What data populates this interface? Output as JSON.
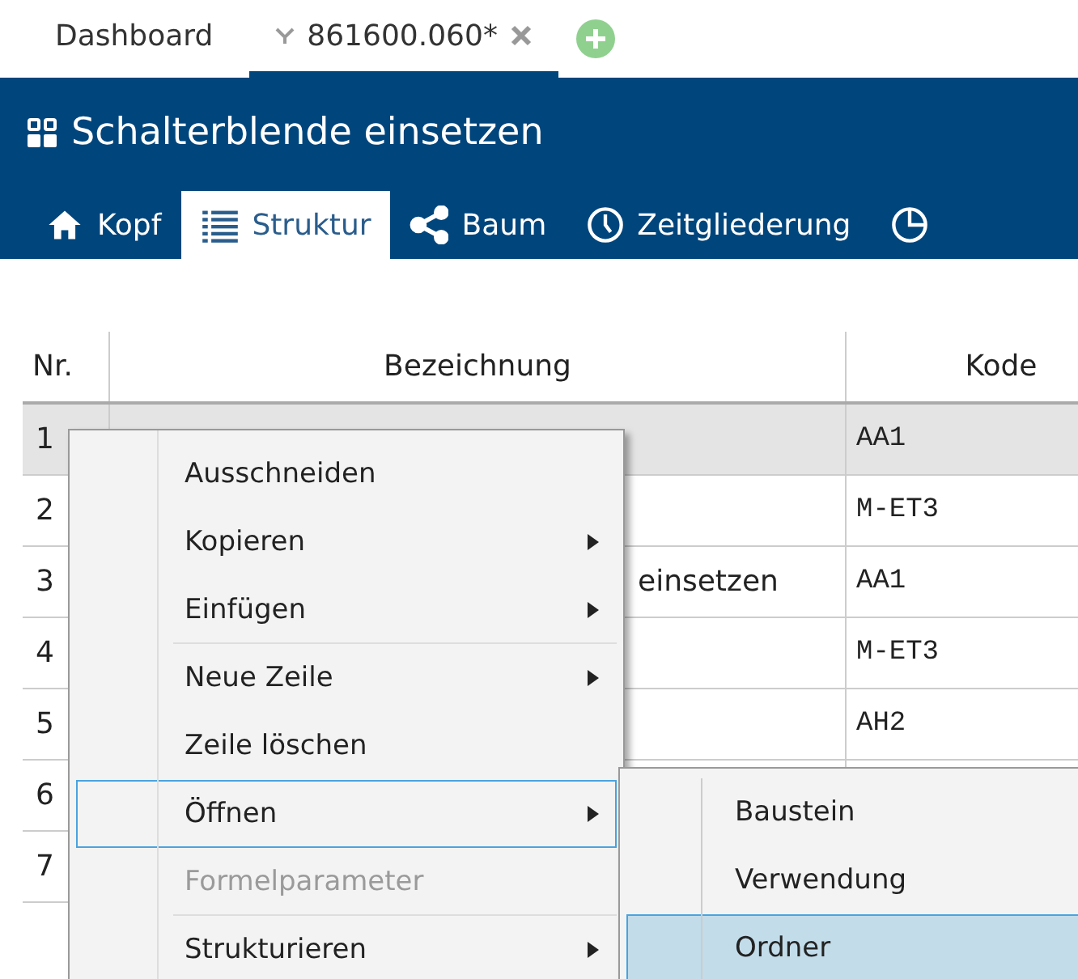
{
  "doc_tabs": [
    {
      "label": "Dashboard",
      "selected": false,
      "closable": false
    },
    {
      "label": "861600.060*",
      "selected": true,
      "closable": true
    }
  ],
  "header": {
    "title": "Schalterblende einsetzen"
  },
  "view_tabs": [
    {
      "label": "Kopf",
      "selected": false
    },
    {
      "label": "Struktur",
      "selected": true
    },
    {
      "label": "Baum",
      "selected": false
    },
    {
      "label": "Zeitgliederung",
      "selected": false
    },
    {
      "selected": false
    }
  ],
  "table": {
    "columns": [
      "Nr.",
      "Bezeichnung",
      "Kode"
    ],
    "rows": [
      {
        "nr": "1",
        "kode": "AA1",
        "selected": true
      },
      {
        "nr": "2",
        "kode": "M-ET3",
        "selected": false
      },
      {
        "nr": "3",
        "bezeichnung": "einsetzen",
        "kode": "AA1",
        "selected": false
      },
      {
        "nr": "4",
        "kode": "M-ET3",
        "selected": false
      },
      {
        "nr": "5",
        "kode": "AH2",
        "selected": false
      },
      {
        "nr": "6",
        "selected": false
      },
      {
        "nr": "7",
        "selected": false
      }
    ]
  },
  "context_menu": [
    {
      "kind": "item",
      "label": "Ausschneiden",
      "submenu": false,
      "disabled": false,
      "selected": false
    },
    {
      "kind": "item",
      "label": "Kopieren",
      "submenu": true,
      "disabled": false,
      "selected": false
    },
    {
      "kind": "item",
      "label": "Einfügen",
      "submenu": true,
      "disabled": false,
      "selected": false
    },
    {
      "kind": "separator"
    },
    {
      "kind": "item",
      "label": "Neue Zeile",
      "submenu": true,
      "disabled": false,
      "selected": false
    },
    {
      "kind": "item",
      "label": "Zeile löschen",
      "submenu": false,
      "disabled": false,
      "selected": false
    },
    {
      "kind": "item",
      "label": "Öffnen",
      "submenu": true,
      "disabled": false,
      "selected": true
    },
    {
      "kind": "item",
      "label": "Formelparameter",
      "submenu": false,
      "disabled": true,
      "selected": false
    },
    {
      "kind": "separator"
    },
    {
      "kind": "item",
      "label": "Strukturieren",
      "submenu": true,
      "disabled": false,
      "selected": false
    }
  ],
  "submenu": [
    {
      "label": "Baustein",
      "selected": false
    },
    {
      "label": "Verwendung",
      "selected": false
    },
    {
      "label": "Ordner",
      "selected": true
    }
  ]
}
